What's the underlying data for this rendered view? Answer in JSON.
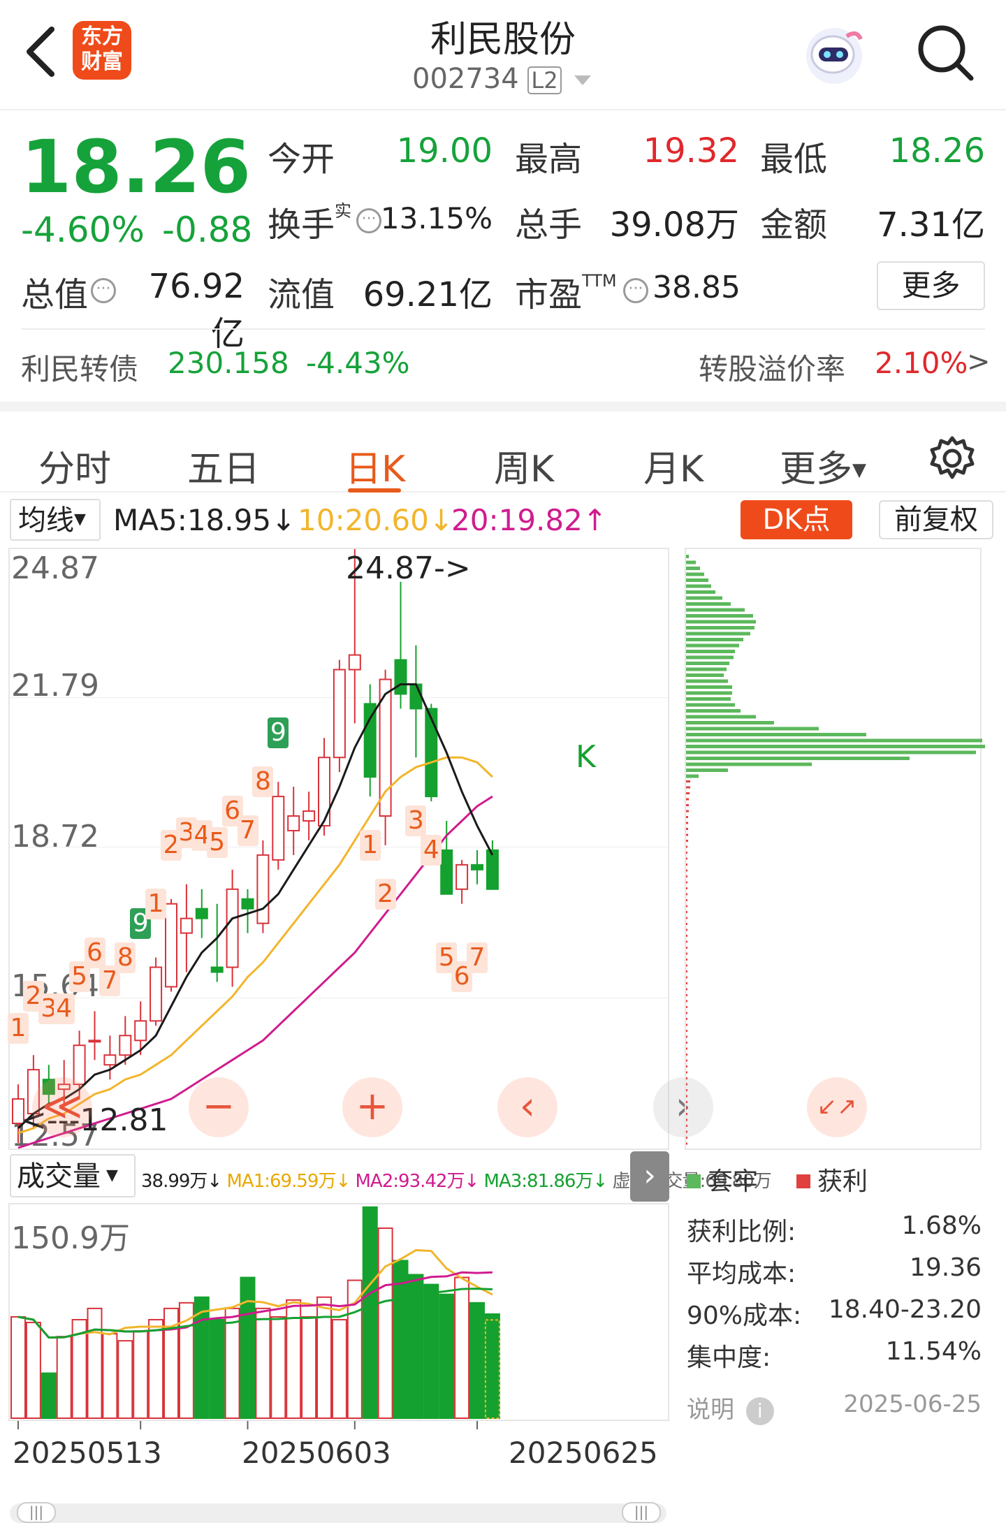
{
  "header": {
    "logo_line1": "东方",
    "logo_line2": "财富",
    "title": "利民股份",
    "code": "002734",
    "level_badge": "L2"
  },
  "quote": {
    "price": "18.26",
    "pct": "-4.60%",
    "chg": "-0.88",
    "open_label": "今开",
    "open": "19.00",
    "high_label": "最高",
    "high": "19.32",
    "low_label": "最低",
    "low": "18.26",
    "turnover_label": "换手",
    "turnover_sup": "实",
    "turnover": "13.15%",
    "vol_label": "总手",
    "vol": "39.08万",
    "amount_label": "金额",
    "amount": "7.31亿",
    "mcap_label": "总值",
    "mcap": "76.92亿",
    "float_label": "流值",
    "float": "69.21亿",
    "pe_label": "市盈",
    "pe_sup": "TTM",
    "pe": "38.85",
    "more": "更多"
  },
  "bond": {
    "name": "利民转债",
    "price": "230.158",
    "pct": "-4.43%",
    "premium_label": "转股溢价率",
    "premium": "2.10%",
    "arrow": ">"
  },
  "tabs": [
    "分时",
    "五日",
    "日K",
    "周K",
    "月K",
    "更多"
  ],
  "active_tab": "日K",
  "ma_bar": {
    "selector": "均线",
    "ma5": "MA5:18.95↓",
    "ma10": "10:20.60↓",
    "ma20": "20:19.82↑",
    "dk": "DK点",
    "fq": "前复权"
  },
  "kline": {
    "y_labels": [
      "24.87",
      "21.79",
      "18.72",
      "15.64",
      "12.57"
    ],
    "high_note": "24.87->",
    "low_note": "<---12.81",
    "seq_labels": [
      {
        "t": "1",
        "s": "r"
      },
      {
        "t": "2",
        "s": "r"
      },
      {
        "t": "3",
        "s": "r"
      },
      {
        "t": "4",
        "s": "r"
      },
      {
        "t": "5",
        "s": "r"
      },
      {
        "t": "6",
        "s": "r"
      },
      {
        "t": "7",
        "s": "r"
      },
      {
        "t": "8",
        "s": "r"
      },
      {
        "t": "9",
        "s": "g"
      },
      {
        "t": "1",
        "s": "r"
      },
      {
        "t": "2",
        "s": "r"
      },
      {
        "t": "3",
        "s": "r"
      },
      {
        "t": "4",
        "s": "r"
      },
      {
        "t": "5",
        "s": "r"
      },
      {
        "t": "6",
        "s": "r"
      },
      {
        "t": "7",
        "s": "r"
      },
      {
        "t": "8",
        "s": "r"
      },
      {
        "t": "9",
        "s": "g"
      },
      {
        "t": "1",
        "s": "r"
      },
      {
        "t": "2",
        "s": "r"
      },
      {
        "t": "3",
        "s": "r"
      },
      {
        "t": "4",
        "s": "r"
      },
      {
        "t": "5",
        "s": "r"
      },
      {
        "t": "6",
        "s": "r"
      },
      {
        "t": "7",
        "s": "r"
      }
    ],
    "k_marker": "K",
    "controls": [
      "≪",
      "−",
      "+",
      "‹",
      "›",
      "↙↗"
    ]
  },
  "chart_data": {
    "type": "candlestick",
    "ylim": [
      12.57,
      24.87
    ],
    "candles": [
      {
        "o": 13.1,
        "h": 13.9,
        "l": 12.7,
        "c": 13.6
      },
      {
        "o": 13.3,
        "h": 14.5,
        "l": 13.0,
        "c": 14.2
      },
      {
        "o": 14.0,
        "h": 14.3,
        "l": 13.5,
        "c": 13.7
      },
      {
        "o": 13.8,
        "h": 14.4,
        "l": 13.4,
        "c": 13.9
      },
      {
        "o": 13.9,
        "h": 15.0,
        "l": 13.6,
        "c": 14.7
      },
      {
        "o": 14.8,
        "h": 15.4,
        "l": 14.4,
        "c": 14.8
      },
      {
        "o": 14.3,
        "h": 14.9,
        "l": 14.0,
        "c": 14.5
      },
      {
        "o": 14.5,
        "h": 15.3,
        "l": 14.3,
        "c": 14.9
      },
      {
        "o": 14.8,
        "h": 15.6,
        "l": 14.5,
        "c": 15.2
      },
      {
        "o": 15.2,
        "h": 16.5,
        "l": 15.1,
        "c": 16.3
      },
      {
        "o": 15.9,
        "h": 17.7,
        "l": 15.8,
        "c": 17.6
      },
      {
        "o": 17.0,
        "h": 18.0,
        "l": 16.2,
        "c": 17.3
      },
      {
        "o": 17.5,
        "h": 17.9,
        "l": 16.9,
        "c": 17.3
      },
      {
        "o": 16.3,
        "h": 17.6,
        "l": 16.0,
        "c": 16.2
      },
      {
        "o": 16.3,
        "h": 18.3,
        "l": 15.9,
        "c": 17.9
      },
      {
        "o": 17.7,
        "h": 17.9,
        "l": 17.0,
        "c": 17.5
      },
      {
        "o": 17.2,
        "h": 18.9,
        "l": 17.0,
        "c": 18.6
      },
      {
        "o": 18.5,
        "h": 20.1,
        "l": 18.3,
        "c": 19.8
      },
      {
        "o": 19.1,
        "h": 20.0,
        "l": 18.6,
        "c": 19.4
      },
      {
        "o": 19.3,
        "h": 19.9,
        "l": 18.9,
        "c": 19.5
      },
      {
        "o": 19.2,
        "h": 21.0,
        "l": 19.0,
        "c": 20.6
      },
      {
        "o": 20.6,
        "h": 22.6,
        "l": 20.3,
        "c": 22.4
      },
      {
        "o": 22.4,
        "h": 24.87,
        "l": 21.3,
        "c": 22.7
      },
      {
        "o": 21.7,
        "h": 22.1,
        "l": 19.8,
        "c": 20.2
      },
      {
        "o": 19.4,
        "h": 22.4,
        "l": 18.8,
        "c": 22.2
      },
      {
        "o": 22.6,
        "h": 24.2,
        "l": 21.6,
        "c": 21.9
      },
      {
        "o": 22.1,
        "h": 22.9,
        "l": 20.6,
        "c": 21.6
      },
      {
        "o": 21.6,
        "h": 21.7,
        "l": 19.7,
        "c": 19.8
      },
      {
        "o": 18.7,
        "h": 19.3,
        "l": 17.8,
        "c": 17.8
      },
      {
        "o": 17.9,
        "h": 18.5,
        "l": 17.6,
        "c": 18.4
      },
      {
        "o": 18.4,
        "h": 18.7,
        "l": 18.0,
        "c": 18.3
      },
      {
        "o": 18.7,
        "h": 18.9,
        "l": 17.9,
        "c": 17.9
      }
    ],
    "ma5": [
      13.0,
      13.3,
      13.5,
      13.6,
      13.8,
      14.1,
      14.2,
      14.4,
      14.6,
      14.9,
      15.5,
      16.1,
      16.6,
      16.9,
      17.3,
      17.4,
      17.5,
      17.8,
      18.3,
      18.8,
      19.3,
      20.0,
      20.8,
      21.4,
      21.9,
      22.1,
      22.1,
      21.4,
      20.7,
      19.9,
      19.2,
      18.6
    ],
    "ma10": [
      12.9,
      13.0,
      13.2,
      13.3,
      13.5,
      13.7,
      13.8,
      14.0,
      14.1,
      14.3,
      14.5,
      14.8,
      15.1,
      15.4,
      15.7,
      16.1,
      16.4,
      16.8,
      17.2,
      17.6,
      18.0,
      18.4,
      18.9,
      19.4,
      19.9,
      20.2,
      20.4,
      20.5,
      20.6,
      20.6,
      20.5,
      20.2
    ],
    "ma20": [
      12.6,
      12.7,
      12.8,
      12.9,
      13.0,
      13.1,
      13.2,
      13.3,
      13.4,
      13.5,
      13.6,
      13.8,
      14.0,
      14.2,
      14.4,
      14.6,
      14.8,
      15.1,
      15.4,
      15.7,
      16.0,
      16.3,
      16.6,
      17.0,
      17.4,
      17.8,
      18.2,
      18.6,
      19.0,
      19.3,
      19.6,
      19.8
    ]
  },
  "volume": {
    "selector": "成交量",
    "values": "38.99万↓",
    "ma1": "MA1:69.59万↓",
    "ma2": "MA2:93.42万↓",
    "ma3": "MA3:81.86万↓",
    "virt": "虚拟成交量:69.80万",
    "y_label": "150.9万",
    "bars": [
      72,
      68,
      32,
      58,
      70,
      78,
      60,
      55,
      62,
      70,
      78,
      82,
      86,
      70,
      78,
      100,
      78,
      72,
      84,
      72,
      86,
      70,
      98,
      150,
      135,
      112,
      102,
      95,
      88,
      100,
      82,
      74
    ],
    "virtual_bar": 69.8,
    "dates": [
      "20250513",
      "20250603",
      "20250625"
    ]
  },
  "chips": {
    "legend_trap": "套牢",
    "legend_profit": "获利",
    "profit_ratio_label": "获利比例:",
    "profit_ratio": "1.68%",
    "avg_cost_label": "平均成本:",
    "avg_cost": "19.36",
    "cost90_label": "90%成本:",
    "cost90": "18.40-23.20",
    "conc_label": "集中度:",
    "conc": "11.54%",
    "note_label": "说明",
    "date": "2025-06-25"
  },
  "colors": {
    "up": "#d8323a",
    "down": "#15a12f",
    "accent": "#e85a1b",
    "ma5": "#1a1a1a",
    "ma10": "#f2b52b",
    "ma20": "#cf1c8e"
  }
}
